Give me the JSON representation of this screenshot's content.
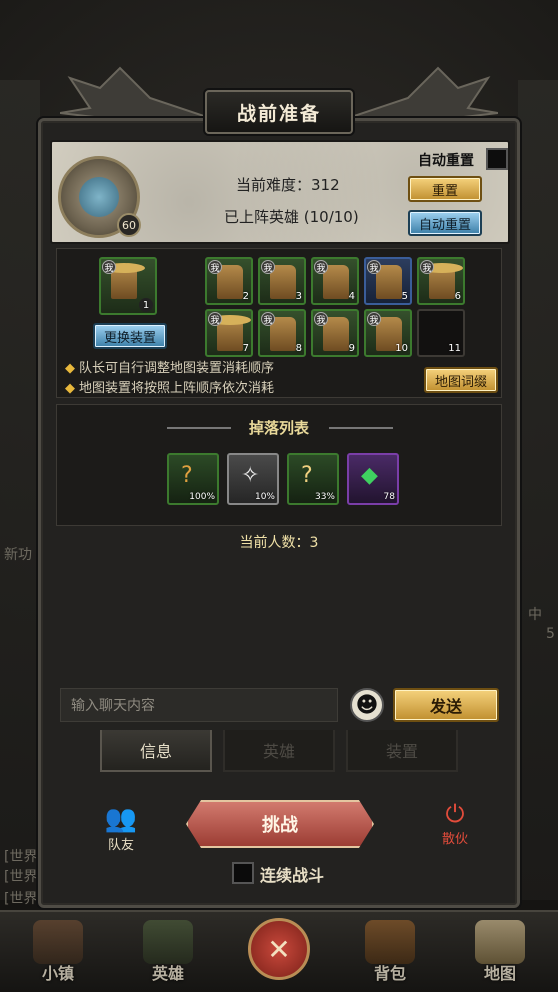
{
  "title": "战前准备",
  "header": {
    "auto_reset_label": "自动重置",
    "difficulty_text": "当前难度：312",
    "hero_count_text": "已上阵英雄 (10/10)",
    "reset_button": "重置",
    "auto_reset_button": "自动重置",
    "avatar_level": "60"
  },
  "heroes": {
    "leader_number": "1",
    "change_equipment_button": "更换装置",
    "me_tag": "我",
    "slot_numbers": [
      "2",
      "3",
      "4",
      "5",
      "6",
      "7",
      "8",
      "9",
      "10",
      "11"
    ],
    "notes": [
      "队长可自行调整地图装置消耗顺序",
      "地图装置将按照上阵顺序依次消耗"
    ],
    "map_affix_button": "地图词缀"
  },
  "drops": {
    "title": "掉落列表",
    "items": [
      {
        "glyph": "?",
        "percent": "100%",
        "rarity": "green"
      },
      {
        "glyph": "✧",
        "percent": "10%",
        "rarity": "grey"
      },
      {
        "glyph": "?",
        "percent": "33%",
        "rarity": "green"
      },
      {
        "glyph": "◆",
        "percent": "78",
        "rarity": "purple"
      }
    ]
  },
  "people_count_text": "当前人数：3",
  "chat": {
    "placeholder": "输入聊天内容",
    "send_button": "发送"
  },
  "tabs": [
    "信息",
    "英雄",
    "装置"
  ],
  "actions": {
    "friends_label": "队友",
    "challenge_button": "挑战",
    "disband_label": "散伙",
    "continuous_battle_label": "连续战斗"
  },
  "nav": [
    "小镇",
    "英雄",
    "背包",
    "地图"
  ],
  "background_text": {
    "left_1": "新功",
    "left_2": "[世界",
    "left_3": "[世界",
    "left_4": "[世界",
    "right_1": "中",
    "right_2": "5"
  },
  "colors": {
    "accent_gold": "#e8b83c",
    "challenge_red": "#9c3d34",
    "disband_red": "#e24c3b"
  }
}
